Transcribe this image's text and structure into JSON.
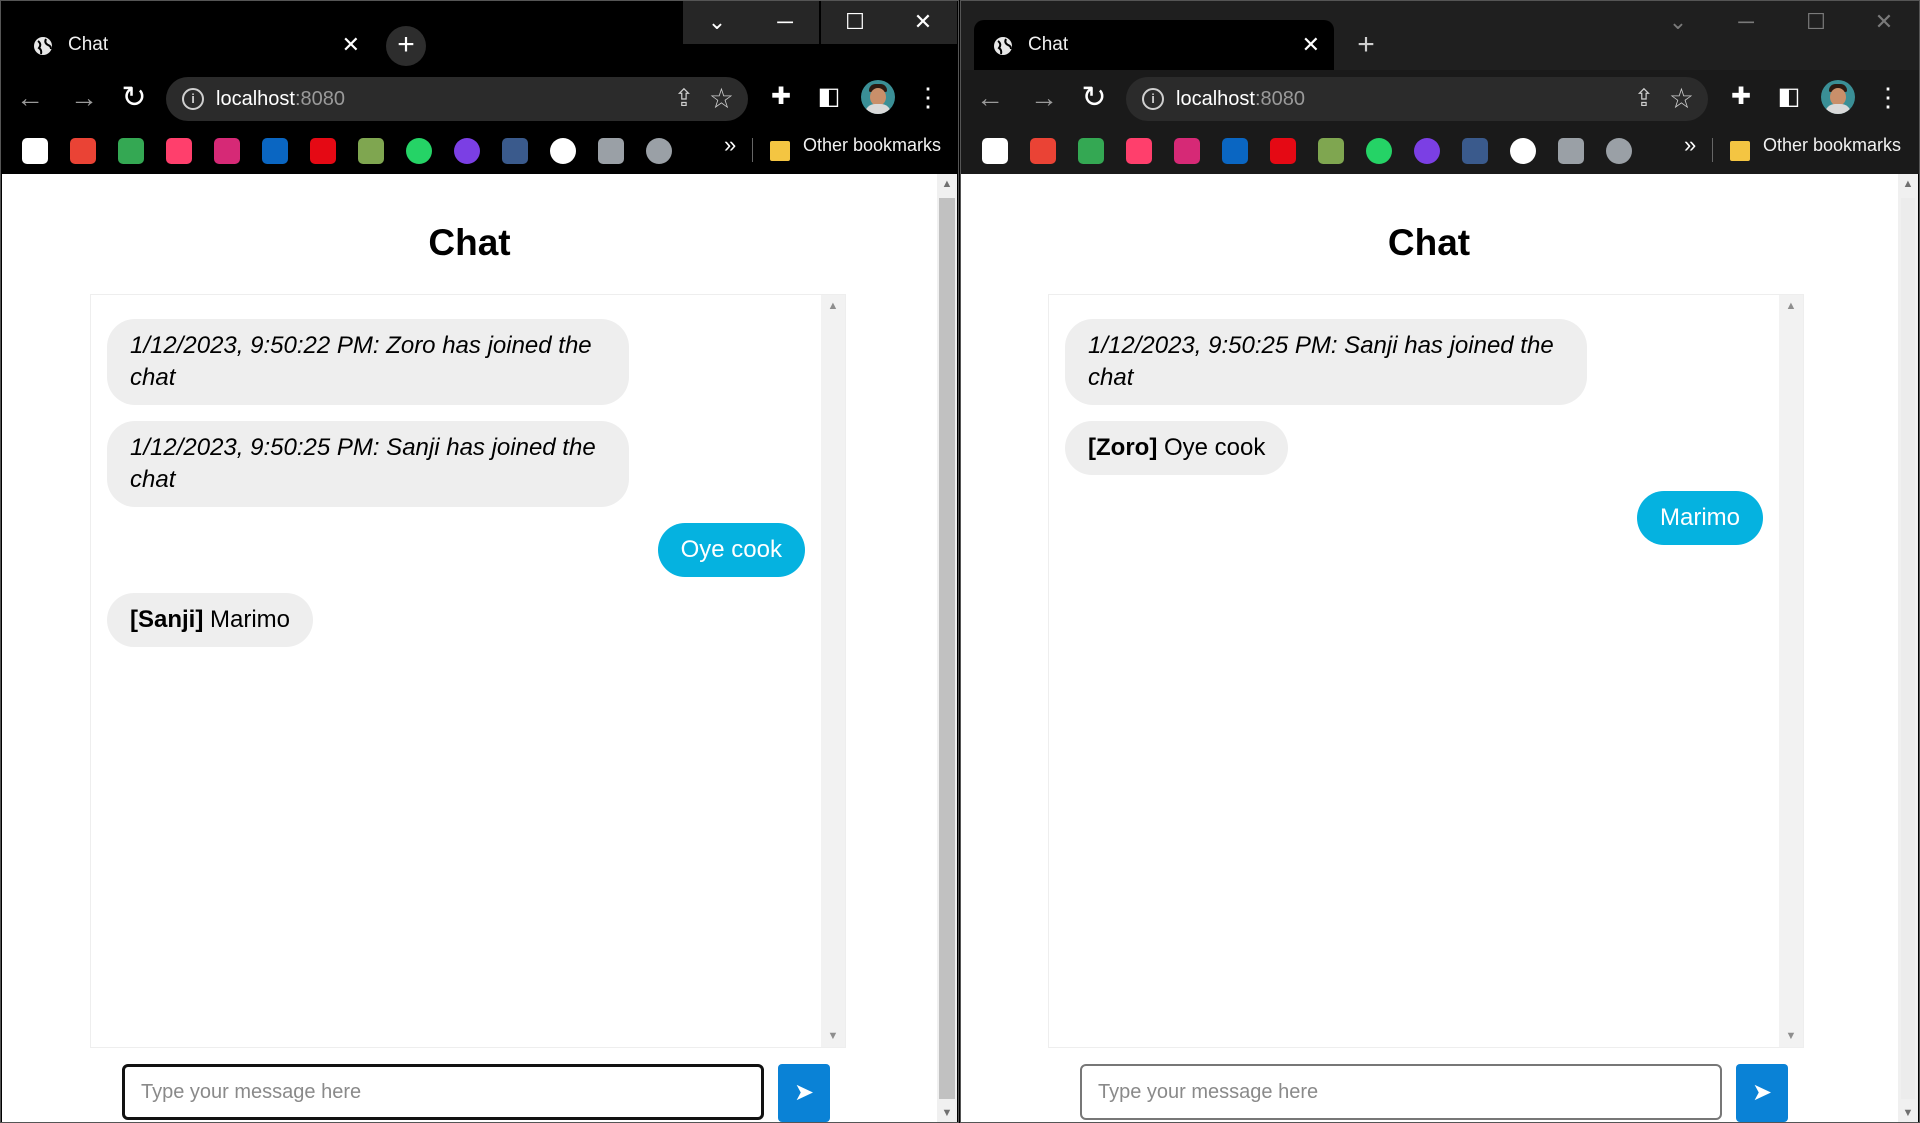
{
  "windows": {
    "left": {
      "tab_title": "Chat",
      "url_host": "localhost",
      "url_port": ":8080",
      "bookmarks_other": "Other bookmarks",
      "page_title": "Chat",
      "messages": [
        {
          "kind": "system",
          "text": "1/12/2023, 9:50:22 PM: Zoro has joined the chat"
        },
        {
          "kind": "system",
          "text": "1/12/2023, 9:50:25 PM: Sanji has joined the chat"
        },
        {
          "kind": "own",
          "text": "Oye cook"
        },
        {
          "kind": "other",
          "sender": "[Sanji]",
          "text": "Marimo"
        }
      ],
      "input_placeholder": "Type your message here",
      "send_label": "➤"
    },
    "right": {
      "tab_title": "Chat",
      "url_host": "localhost",
      "url_port": ":8080",
      "bookmarks_other": "Other bookmarks",
      "page_title": "Chat",
      "messages": [
        {
          "kind": "system",
          "text": "1/12/2023, 9:50:25 PM: Sanji has joined the chat"
        },
        {
          "kind": "other",
          "sender": "[Zoro]",
          "text": "Oye cook"
        },
        {
          "kind": "own",
          "text": "Marimo"
        }
      ],
      "input_placeholder": "Type your message here",
      "send_label": "➤"
    }
  },
  "chrome": {
    "close_glyph": "✕",
    "newtab_glyph": "+",
    "bookmark_overflow": "»",
    "bookmark_icons": [
      "google-icon",
      "gmail-icon",
      "drive-icon",
      "myntra-icon",
      "instagram-icon",
      "linkedin-icon",
      "netflix-icon",
      "chess-icon",
      "whatsapp-icon",
      "upwork-icon",
      "codechef-icon",
      "github-icon",
      "stairs-icon",
      "globe-icon"
    ],
    "bookmark_colors": [
      "#4285f4",
      "#ea4335",
      "#34a853",
      "#ff3f6c",
      "#d62976",
      "#0a66c2",
      "#e50914",
      "#7fa650",
      "#25d366",
      "#7b3fe4",
      "#3a5a8c",
      "#ffffff",
      "#9aa0a6",
      "#9aa0a6"
    ]
  },
  "colors": {
    "own_bubble": "#05b2e0",
    "other_bubble": "#eeeeee",
    "send_button": "#0a82d6"
  }
}
